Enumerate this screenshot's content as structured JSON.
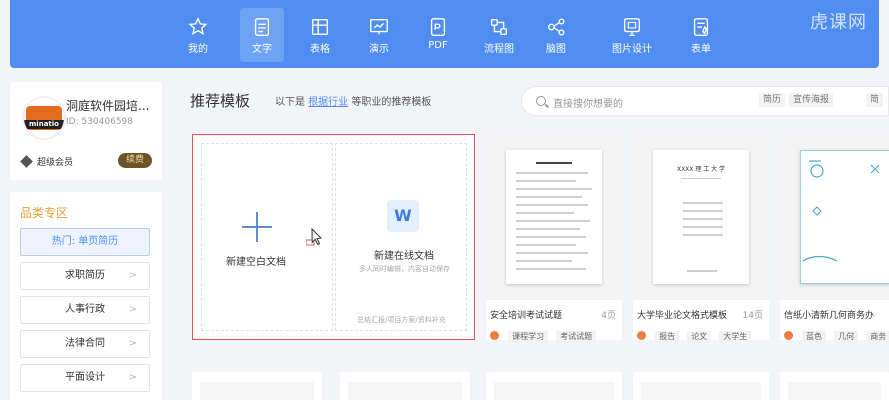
{
  "toolbar": {
    "items": [
      {
        "label": "我的",
        "icon": "star-icon"
      },
      {
        "label": "文字",
        "icon": "document-icon",
        "active": true
      },
      {
        "label": "表格",
        "icon": "table-icon"
      },
      {
        "label": "演示",
        "icon": "presentation-icon"
      },
      {
        "label": "PDF",
        "icon": "pdf-icon"
      },
      {
        "label": "流程图",
        "icon": "flowchart-icon"
      },
      {
        "label": "脑图",
        "icon": "mindmap-icon"
      },
      {
        "label": "图片设计",
        "icon": "image-design-icon"
      },
      {
        "label": "表单",
        "icon": "form-icon"
      }
    ],
    "watermark": "虎课网",
    "accent": "#4f8ef0"
  },
  "profile": {
    "name": "洞庭软件园培...",
    "id": "ID: 530406598",
    "avatar_text": "minatio",
    "member": "超级会员",
    "renew": "续费"
  },
  "categories": {
    "title": "品类专区",
    "items": [
      {
        "label": "热门: 单页简历",
        "active": true
      },
      {
        "label": "求职简历"
      },
      {
        "label": "人事行政"
      },
      {
        "label": "法律合同"
      },
      {
        "label": "平面设计"
      }
    ]
  },
  "main": {
    "title": "推荐模板",
    "subtitle_prefix": "以下是",
    "subtitle_link": "根据行业",
    "subtitle_suffix": "等职业的推荐模板",
    "search_placeholder": "直接搜你想要的",
    "search_tags": [
      "简历",
      "宣传海报",
      "简"
    ]
  },
  "create": {
    "blank_label": "新建空白文档",
    "online_label": "新建在线文档",
    "online_desc": "多人同时编辑，内容自动保存",
    "online_foot": "总结汇报/项目方案/资料补充",
    "w_letter": "W"
  },
  "templates": [
    {
      "name": "安全培训考试试题",
      "count": "4页",
      "tags": [
        "课程学习",
        "考试试题"
      ]
    },
    {
      "name": "大学毕业论文格式模板",
      "count": "14页",
      "tags": [
        "报告",
        "论文",
        "大学生"
      ],
      "doc_title": "XXXX 理 工 大 学"
    },
    {
      "name": "信纸小清新几何商务办",
      "count": "",
      "tags": [
        "蓝色",
        "几何",
        "商务"
      ]
    }
  ]
}
